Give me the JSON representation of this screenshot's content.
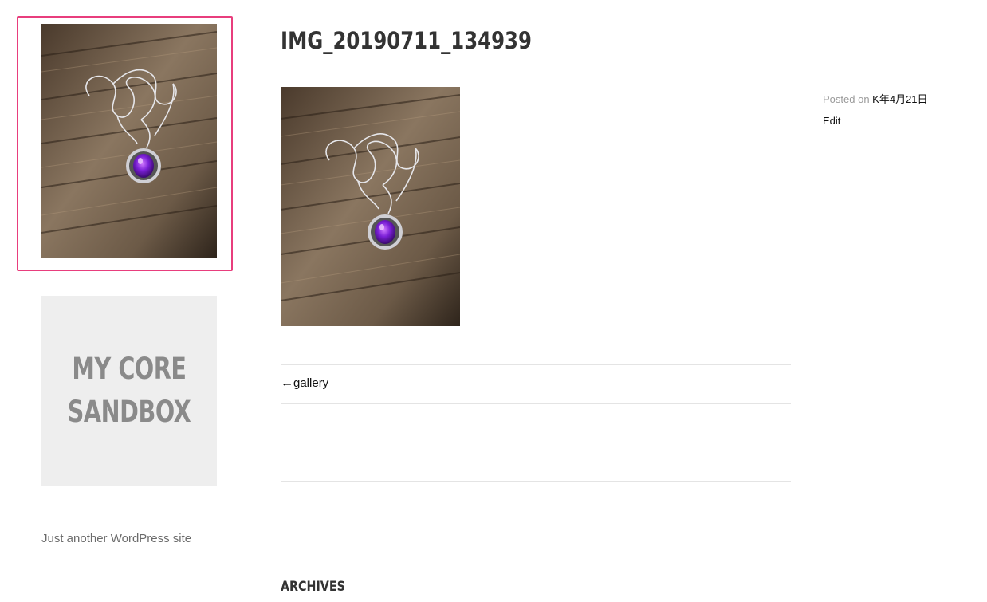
{
  "sidebar": {
    "logo_alt": "",
    "site_title_line1": "MY CORE",
    "site_title_line2": "SANDBOX",
    "tagline": "Just another WordPress site"
  },
  "entry": {
    "title": "IMG_20190711_134939",
    "posted_label": "Posted on",
    "posted_date": "K年4月21日",
    "edit_label": "Edit"
  },
  "navigation": {
    "previous_arrow": "←",
    "previous_label": "gallery"
  },
  "widgets": {
    "archives_title": "ARCHIVES"
  },
  "colors": {
    "focus_ring": "#e83e7d",
    "title_box_bg": "#eeeeee",
    "title_box_text": "#8a8a8a"
  }
}
